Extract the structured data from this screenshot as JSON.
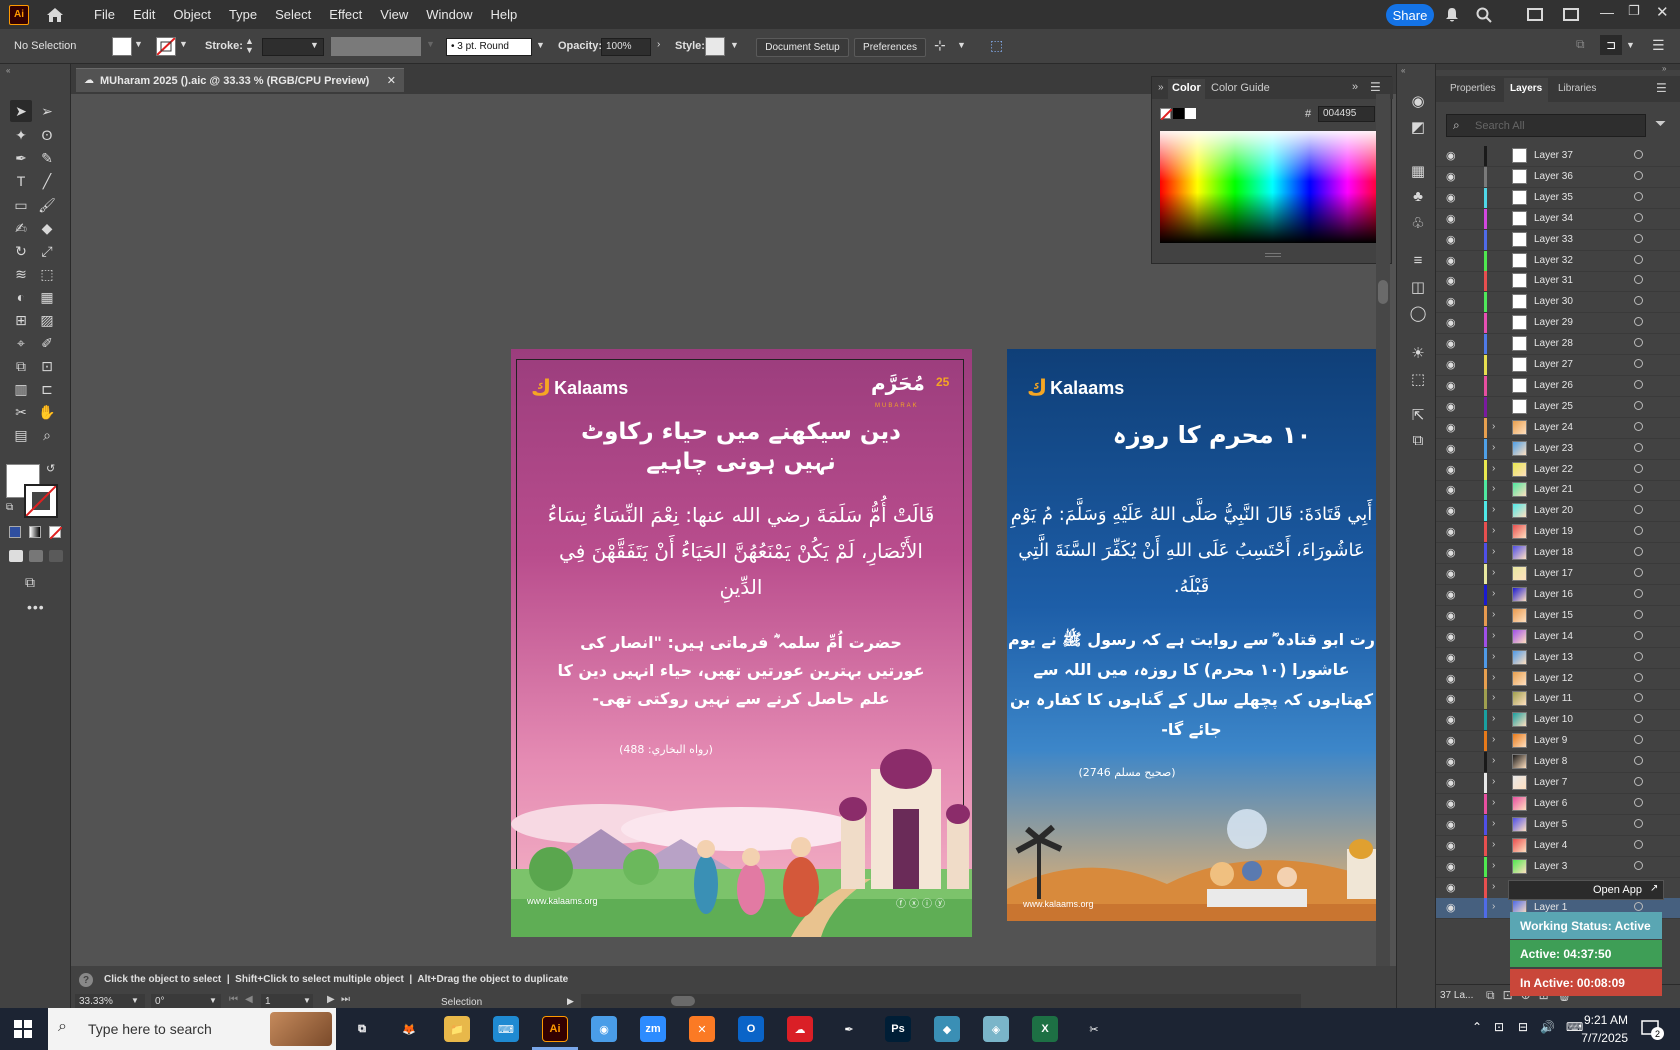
{
  "app": {
    "menu": [
      "File",
      "Edit",
      "Object",
      "Type",
      "Select",
      "Effect",
      "View",
      "Window",
      "Help"
    ],
    "share_label": "Share",
    "logo_text": "Ai"
  },
  "control": {
    "selection": "No Selection",
    "stroke_label": "Stroke:",
    "brush": "3 pt. Round",
    "opacity_label": "Opacity:",
    "opacity_value": "100%",
    "style_label": "Style:",
    "document_setup": "Document Setup",
    "preferences": "Preferences"
  },
  "document": {
    "tab_title": "MUharam 2025 ().aic @ 33.33 % (RGB/CPU Preview)"
  },
  "artboard1": {
    "brand": "Kalaams",
    "badge_num": "25",
    "badge_title": "مُحَرَّم",
    "badge_sub": "MUBARAK",
    "heading": "دین سیکھنے میں حیاء رکاوٹ نہیں ہونی چاہیے",
    "arabic": "قَالَتْ أُمُّ سَلَمَةَ رضي الله عنها: نِعْمَ النِّسَاءُ نِسَاءُ الأَنْصَارِ، لَمْ يَكُنْ يَمْنَعُهُنَّ الحَيَاءُ أَنْ يَتَفَقَّهْنَ فِي الدِّينِ",
    "urdu": "حضرت اُمِّ سلمہ ؓ فرماتی ہیں: \"انصار کی عورتیں بہترین عورتیں تھیں، حیاء انہیں دین کا علم حاصل کرنے سے نہیں روکتی تھی-",
    "reference": "(رواه البخاري: 488)",
    "website": "www.kalaams.org"
  },
  "artboard2": {
    "brand": "Kalaams",
    "heading": "۱۰ محرم کا روزہ",
    "arabic": "أَبِي قَتَادَةَ: قَالَ النَّبِيُّ صَلَّى اللهُ عَلَيْهِ وَسَلَّمَ: مُ يَوْمِ عَاشُورَاءَ، أَحْتَسِبُ عَلَى اللهِ أَنْ يُكَفِّرَ السَّنَةَ الَّتِي قَبْلَهُ.",
    "urdu": "رت ابو قتادہ ؓ سے روایت ہے کہ رسول ﷺ نے یوم عاشورا (۱۰ محرم) کا روزہ، میں اللہ سے کھتاہوں کہ پچھلے سال کے گناہوں کا کفارہ بن جائے گا-",
    "reference": "(صحیح مسلم 2746)",
    "website": "www.kalaams.org"
  },
  "color_panel": {
    "tab_color": "Color",
    "tab_guide": "Color Guide",
    "hex_label": "#",
    "hex_value": "004495"
  },
  "layers_panel": {
    "tabs": [
      "Properties",
      "Layers",
      "Libraries"
    ],
    "search_placeholder": "Search All",
    "layers": [
      {
        "name": "Layer 37",
        "color": "#1a1a1a",
        "expand": false
      },
      {
        "name": "Layer 36",
        "color": "#7a7a7a",
        "expand": false
      },
      {
        "name": "Layer 35",
        "color": "#4fd7e8",
        "expand": false
      },
      {
        "name": "Layer 34",
        "color": "#d347e0",
        "expand": false
      },
      {
        "name": "Layer 33",
        "color": "#4f6be8",
        "expand": false
      },
      {
        "name": "Layer 32",
        "color": "#4fe84f",
        "expand": false
      },
      {
        "name": "Layer 31",
        "color": "#e84f4f",
        "expand": false
      },
      {
        "name": "Layer 30",
        "color": "#4fe85a",
        "expand": false
      },
      {
        "name": "Layer 29",
        "color": "#e84fb4",
        "expand": false
      },
      {
        "name": "Layer 28",
        "color": "#4f7ae8",
        "expand": false
      },
      {
        "name": "Layer 27",
        "color": "#e8e04f",
        "expand": false
      },
      {
        "name": "Layer 26",
        "color": "#e84fa0",
        "expand": false
      },
      {
        "name": "Layer 25",
        "color": "#7a1aa0",
        "expand": false
      },
      {
        "name": "Layer 24",
        "color": "#e8a04f",
        "expand": true
      },
      {
        "name": "Layer 23",
        "color": "#4fa0e8",
        "expand": true
      },
      {
        "name": "Layer 22",
        "color": "#e8e84f",
        "expand": true
      },
      {
        "name": "Layer 21",
        "color": "#4fe8a0",
        "expand": true
      },
      {
        "name": "Layer 20",
        "color": "#4fe8e8",
        "expand": true
      },
      {
        "name": "Layer 19",
        "color": "#e84f4f",
        "expand": true
      },
      {
        "name": "Layer 18",
        "color": "#4f4fe8",
        "expand": true
      },
      {
        "name": "Layer 17",
        "color": "#e8e8a0",
        "expand": true
      },
      {
        "name": "Layer 16",
        "color": "#1a1ad0",
        "expand": true
      },
      {
        "name": "Layer 15",
        "color": "#e89a4f",
        "expand": true
      },
      {
        "name": "Layer 14",
        "color": "#a04fe8",
        "expand": true
      },
      {
        "name": "Layer 13",
        "color": "#4f9ae8",
        "expand": true
      },
      {
        "name": "Layer 12",
        "color": "#e8a04f",
        "expand": true
      },
      {
        "name": "Layer 11",
        "color": "#a0a04f",
        "expand": true
      },
      {
        "name": "Layer 10",
        "color": "#1aa0a0",
        "expand": true
      },
      {
        "name": "Layer 9",
        "color": "#e87a1a",
        "expand": true
      },
      {
        "name": "Layer 8",
        "color": "#1a1a1a",
        "expand": true
      },
      {
        "name": "Layer 7",
        "color": "#e8e8e8",
        "expand": true
      },
      {
        "name": "Layer 6",
        "color": "#e84fa0",
        "expand": true
      },
      {
        "name": "Layer 5",
        "color": "#4f4fe8",
        "expand": true
      },
      {
        "name": "Layer 4",
        "color": "#e84f4f",
        "expand": true
      },
      {
        "name": "Layer 3",
        "color": "#4fe84f",
        "expand": true
      },
      {
        "name": "Layer 2",
        "color": "#e84f4f",
        "expand": true
      },
      {
        "name": "Layer 1",
        "color": "#4f6be8",
        "expand": true
      }
    ],
    "footer_count": "37 La..."
  },
  "widget": {
    "open_app": "Open App",
    "working_status": "Working Status: Active",
    "active": "Active: 04:37:50",
    "inactive": "In Active: 00:08:09"
  },
  "status": {
    "hint": "Click the object to select  |  Shift+Click to select multiple object  |  Alt+Drag the object to duplicate",
    "zoom": "33.33%",
    "angle": "0°",
    "artboard_num": "1",
    "mode": "Selection"
  },
  "taskbar": {
    "search_placeholder": "Type here to search",
    "time": "9:21 AM",
    "date": "7/7/2025",
    "notif_count": "2"
  }
}
